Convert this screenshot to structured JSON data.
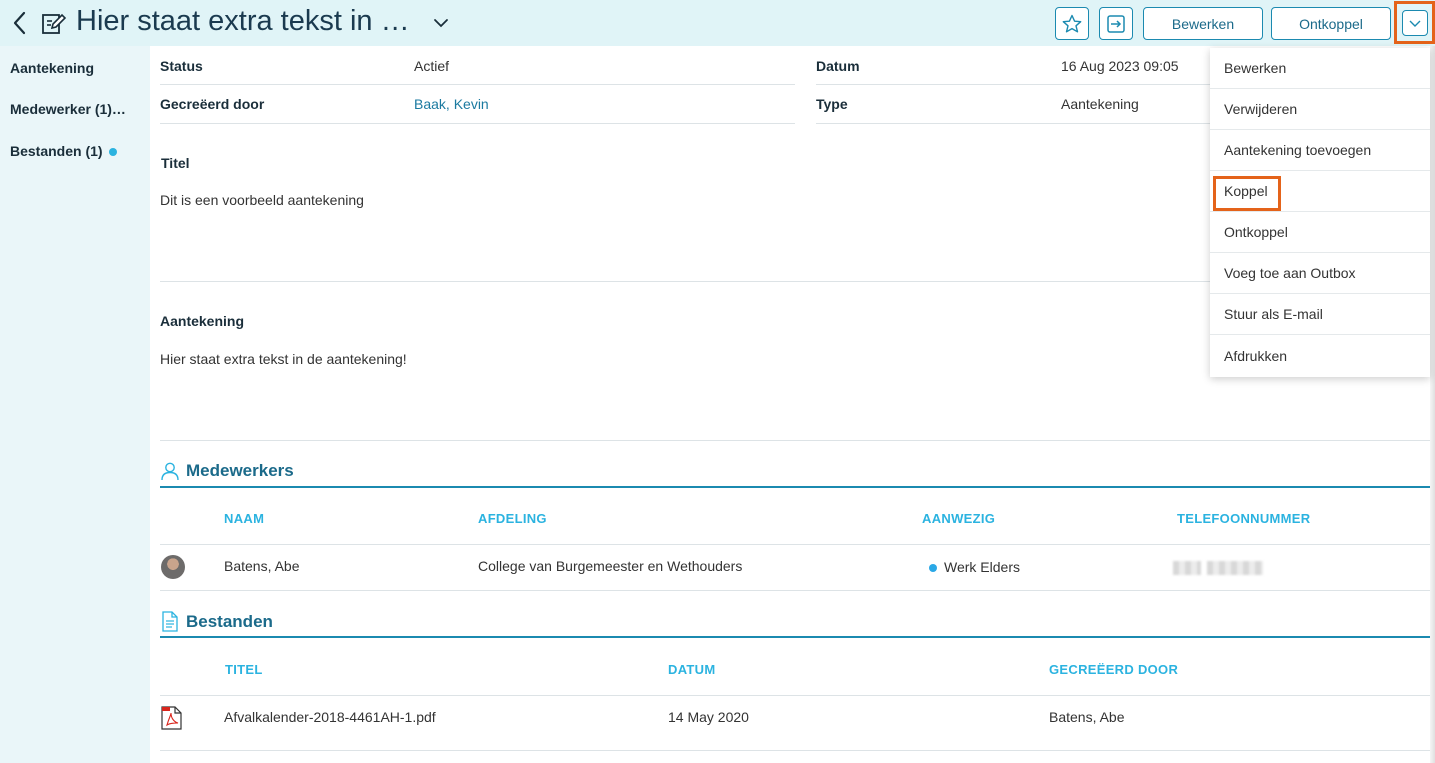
{
  "header": {
    "title": "Hier staat extra tekst in …",
    "buttons": {
      "edit": "Bewerken",
      "unlink": "Ontkoppel"
    },
    "icons": {
      "back": "chevron-left-icon",
      "note": "edit-note-icon",
      "favorite": "star-icon",
      "open": "sign-in-icon",
      "more": "chevron-down-icon"
    }
  },
  "sidebar": {
    "items": [
      {
        "label": "Aantekening"
      },
      {
        "label": "Medewerker (1)…"
      },
      {
        "label": "Bestanden (1)"
      }
    ]
  },
  "fields": {
    "status_label": "Status",
    "status_value": "Actief",
    "created_by_label": "Gecreëerd door",
    "created_by_value": "Baak, Kevin",
    "date_label": "Datum",
    "date_value": "16 Aug 2023 09:05",
    "type_label": "Type",
    "type_value": "Aantekening"
  },
  "sections": {
    "title_label": "Titel",
    "title_text": "Dit is een voorbeeld aantekening",
    "note_label": "Aantekening",
    "note_text": "Hier staat extra tekst in de aantekening!"
  },
  "employees": {
    "heading": "Medewerkers",
    "columns": [
      "NAAM",
      "AFDELING",
      "AANWEZIG",
      "TELEFOONNUMMER"
    ],
    "rows": [
      {
        "name": "Batens, Abe",
        "department": "College van Burgemeester en Wethouders",
        "presence": "Werk Elders"
      }
    ]
  },
  "files": {
    "heading": "Bestanden",
    "columns": [
      "TITEL",
      "DATUM",
      "GECREËERD DOOR"
    ],
    "rows": [
      {
        "title": "Afvalkalender-2018-4461AH-1.pdf",
        "date": "14 May 2020",
        "created_by": "Batens, Abe"
      }
    ]
  },
  "menu": {
    "items": [
      {
        "label": "Bewerken"
      },
      {
        "label": "Verwijderen"
      },
      {
        "label": "Aantekening toevoegen"
      },
      {
        "label": "Koppel"
      },
      {
        "label": "Ontkoppel"
      },
      {
        "label": "Voeg toe aan Outbox"
      },
      {
        "label": "Stuur als E-mail"
      },
      {
        "label": "Afdrukken"
      }
    ]
  },
  "colors": {
    "accent": "#1b8ab0",
    "highlight": "#e4631a",
    "header_bg": "#e0f4f7",
    "table_header": "#2bb3e0"
  }
}
